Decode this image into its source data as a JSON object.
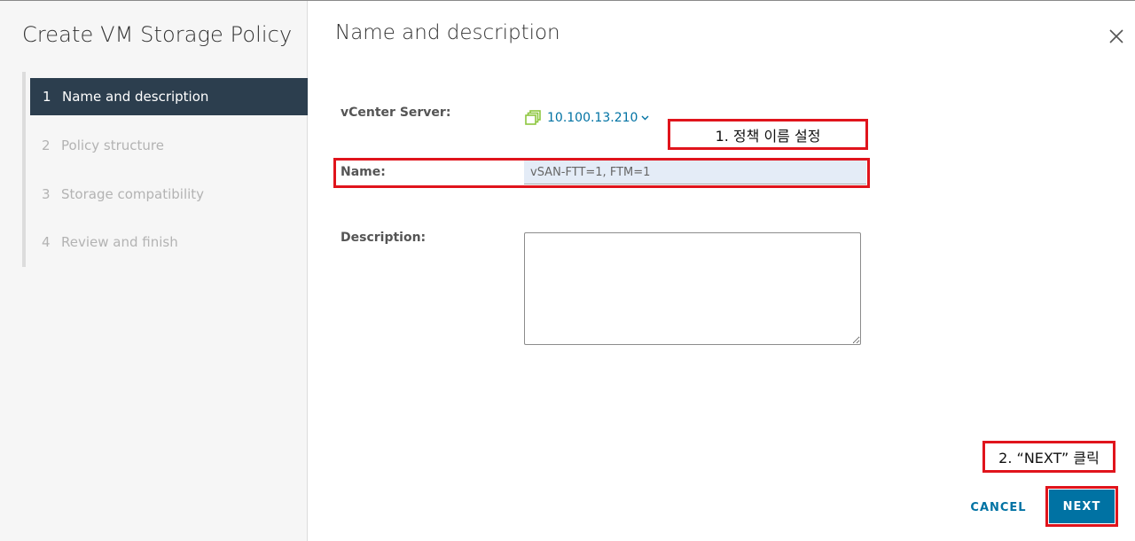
{
  "wizard": {
    "title": "Create VM Storage Policy",
    "steps": [
      {
        "num": "1",
        "label": "Name and description"
      },
      {
        "num": "2",
        "label": "Policy structure"
      },
      {
        "num": "3",
        "label": "Storage compatibility"
      },
      {
        "num": "4",
        "label": "Review and finish"
      }
    ]
  },
  "main": {
    "title": "Name and description",
    "vcenter_label": "vCenter Server:",
    "vcenter_value": "10.100.13.210",
    "name_label": "Name:",
    "name_value": "vSAN-FTT=1, FTM=1",
    "description_label": "Description:",
    "description_value": ""
  },
  "annotations": {
    "step1": "1. 정책 이름 설정",
    "step2": "2. “NEXT” 클릭"
  },
  "footer": {
    "cancel_label": "CANCEL",
    "next_label": "NEXT"
  },
  "icons": [
    "close-icon",
    "vcenter-icon",
    "chevron-down-icon"
  ],
  "colors": {
    "accent": "#0072a3",
    "active_step_bg": "#2c3e4e",
    "annotation": "#e0141c",
    "vcenter_icon": "#8dc63f"
  }
}
